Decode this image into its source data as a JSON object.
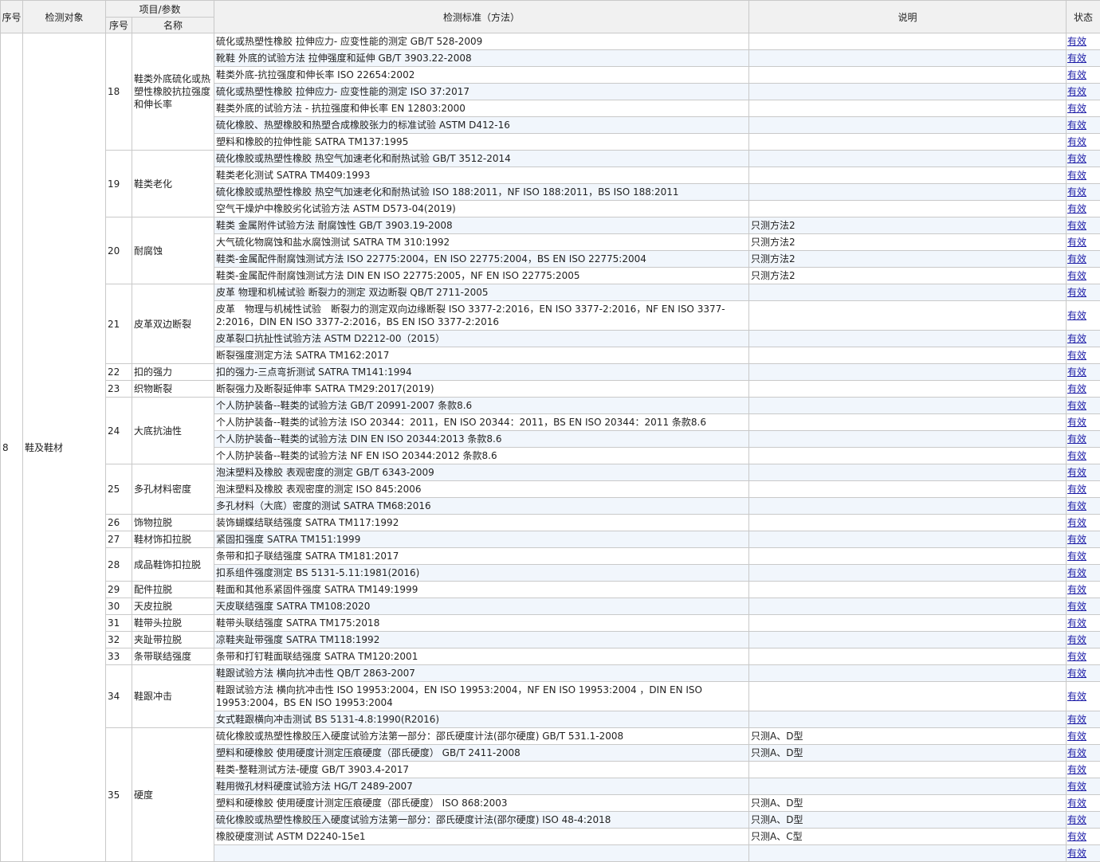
{
  "header": {
    "seq": "序号",
    "object": "检测对象",
    "project": "项目/参数",
    "sub_seq": "序号",
    "sub_name": "名称",
    "standard": "检测标准（方法）",
    "note": "说明",
    "status": "状态"
  },
  "object": {
    "seq": "8",
    "name": "鞋及鞋材"
  },
  "groups": [
    {
      "no": "18",
      "name": "鞋类外底硫化或热塑性橡胶抗拉强度和伸长率",
      "rows": [
        {
          "std": "硫化或热塑性橡胶 拉伸应力- 应变性能的测定 GB/T 528-2009",
          "note": "",
          "status": "有效"
        },
        {
          "std": "靴鞋 外底的试验方法 拉伸强度和延伸 GB/T 3903.22-2008",
          "note": "",
          "status": "有效"
        },
        {
          "std": "鞋类外底-抗拉强度和伸长率 ISO 22654:2002",
          "note": "",
          "status": "有效"
        },
        {
          "std": "硫化或热塑性橡胶 拉伸应力- 应变性能的测定 ISO 37:2017",
          "note": "",
          "status": "有效"
        },
        {
          "std": "鞋类外底的试验方法 - 抗拉强度和伸长率 EN 12803:2000",
          "note": "",
          "status": "有效"
        },
        {
          "std": "硫化橡胶、热塑橡胶和热塑合成橡胶张力的标准试验 ASTM D412-16",
          "note": "",
          "status": "有效"
        },
        {
          "std": "塑料和橡胶的拉伸性能 SATRA TM137:1995",
          "note": "",
          "status": "有效"
        }
      ]
    },
    {
      "no": "19",
      "name": "鞋类老化",
      "rows": [
        {
          "std": "硫化橡胶或热塑性橡胶 热空气加速老化和耐热试验 GB/T 3512-2014",
          "note": "",
          "status": "有效"
        },
        {
          "std": "鞋类老化测试 SATRA TM409:1993",
          "note": "",
          "status": "有效"
        },
        {
          "std": "硫化橡胶或热塑性橡胶 热空气加速老化和耐热试验 ISO 188:2011，NF ISO 188:2011，BS ISO 188:2011",
          "note": "",
          "status": "有效"
        },
        {
          "std": "空气干燥炉中橡胶劣化试验方法 ASTM D573-04(2019)",
          "note": "",
          "status": "有效"
        }
      ]
    },
    {
      "no": "20",
      "name": "耐腐蚀",
      "rows": [
        {
          "std": "鞋类 金属附件试验方法 耐腐蚀性 GB/T 3903.19-2008",
          "note": "只测方法2",
          "status": "有效"
        },
        {
          "std": "大气硫化物腐蚀和盐水腐蚀测试 SATRA TM 310:1992",
          "note": "只测方法2",
          "status": "有效"
        },
        {
          "std": "鞋类-金属配件耐腐蚀测试方法 ISO 22775:2004，EN ISO 22775:2004，BS EN ISO 22775:2004",
          "note": "只测方法2",
          "status": "有效"
        },
        {
          "std": "鞋类-金属配件耐腐蚀测试方法 DIN EN ISO 22775:2005，NF EN ISO 22775:2005",
          "note": "只测方法2",
          "status": "有效"
        }
      ]
    },
    {
      "no": "21",
      "name": "皮革双边断裂",
      "rows": [
        {
          "std": "皮革 物理和机械试验 断裂力的测定 双边断裂 QB/T 2711-2005",
          "note": "",
          "status": "有效"
        },
        {
          "std": "皮革　物理与机械性试验　断裂力的测定双向边缘断裂 ISO 3377-2:2016，EN ISO 3377-2:2016，NF EN ISO 3377-2:2016，DIN EN ISO 3377-2:2016，BS EN ISO 3377-2:2016",
          "note": "",
          "status": "有效",
          "tall": true
        },
        {
          "std": "皮革裂口抗扯性试验方法 ASTM D2212-00（2015）",
          "note": "",
          "status": "有效"
        },
        {
          "std": "断裂强度测定方法 SATRA TM162:2017",
          "note": "",
          "status": "有效"
        }
      ]
    },
    {
      "no": "22",
      "name": "扣的强力",
      "rows": [
        {
          "std": "扣的强力-三点弯折测试 SATRA TM141:1994",
          "note": "",
          "status": "有效"
        }
      ]
    },
    {
      "no": "23",
      "name": "织物断裂",
      "rows": [
        {
          "std": "断裂强力及断裂延伸率 SATRA TM29:2017(2019)",
          "note": "",
          "status": "有效"
        }
      ]
    },
    {
      "no": "24",
      "name": "大底抗油性",
      "rows": [
        {
          "std": "个人防护装备--鞋类的试验方法 GB/T 20991-2007 条款8.6",
          "note": "",
          "status": "有效"
        },
        {
          "std": "个人防护装备--鞋类的试验方法 ISO 20344：2011，EN ISO 20344：2011，BS EN ISO 20344：2011 条款8.6",
          "note": "",
          "status": "有效"
        },
        {
          "std": "个人防护装备--鞋类的试验方法 DIN EN ISO 20344:2013 条款8.6",
          "note": "",
          "status": "有效"
        },
        {
          "std": "个人防护装备--鞋类的试验方法 NF EN ISO 20344:2012 条款8.6",
          "note": "",
          "status": "有效"
        }
      ]
    },
    {
      "no": "25",
      "name": "多孔材料密度",
      "rows": [
        {
          "std": "泡沫塑料及橡胶 表观密度的测定 GB/T 6343-2009",
          "note": "",
          "status": "有效"
        },
        {
          "std": "泡沫塑料及橡胶 表观密度的测定 ISO 845:2006",
          "note": "",
          "status": "有效"
        },
        {
          "std": "多孔材料（大底）密度的测试 SATRA TM68:2016",
          "note": "",
          "status": "有效"
        }
      ]
    },
    {
      "no": "26",
      "name": "饰物拉脱",
      "rows": [
        {
          "std": "装饰蝴蝶结联结强度 SATRA TM117:1992",
          "note": "",
          "status": "有效"
        }
      ]
    },
    {
      "no": "27",
      "name": "鞋材饰扣拉脱",
      "rows": [
        {
          "std": "紧固扣强度 SATRA TM151:1999",
          "note": "",
          "status": "有效"
        }
      ]
    },
    {
      "no": "28",
      "name": "成品鞋饰扣拉脱",
      "rows": [
        {
          "std": "条带和扣子联结强度 SATRA TM181:2017",
          "note": "",
          "status": "有效"
        },
        {
          "std": "扣系组件强度测定 BS 5131-5.11:1981(2016)",
          "note": "",
          "status": "有效"
        }
      ]
    },
    {
      "no": "29",
      "name": "配件拉脱",
      "rows": [
        {
          "std": "鞋面和其他系紧固件强度 SATRA TM149:1999",
          "note": "",
          "status": "有效"
        }
      ]
    },
    {
      "no": "30",
      "name": "天皮拉脱",
      "rows": [
        {
          "std": "天皮联结强度 SATRA TM108:2020",
          "note": "",
          "status": "有效"
        }
      ]
    },
    {
      "no": "31",
      "name": "鞋带头拉脱",
      "rows": [
        {
          "std": "鞋带头联结强度 SATRA TM175:2018",
          "note": "",
          "status": "有效"
        }
      ]
    },
    {
      "no": "32",
      "name": "夹趾带拉脱",
      "rows": [
        {
          "std": "凉鞋夹趾带强度 SATRA TM118:1992",
          "note": "",
          "status": "有效"
        }
      ]
    },
    {
      "no": "33",
      "name": "条带联结强度",
      "rows": [
        {
          "std": "条带和打钉鞋面联结强度 SATRA TM120:2001",
          "note": "",
          "status": "有效"
        }
      ]
    },
    {
      "no": "34",
      "name": "鞋跟冲击",
      "rows": [
        {
          "std": "鞋跟试验方法 横向抗冲击性 QB/T 2863-2007",
          "note": "",
          "status": "有效"
        },
        {
          "std": "鞋跟试验方法 横向抗冲击性 ISO 19953:2004，EN ISO 19953:2004，NF EN ISO 19953:2004 ，DIN EN ISO 19953:2004，BS EN ISO 19953:2004",
          "note": "",
          "status": "有效",
          "tall": true
        },
        {
          "std": "女式鞋跟横向冲击测试 BS 5131-4.8:1990(R2016)",
          "note": "",
          "status": "有效"
        }
      ]
    },
    {
      "no": "35",
      "name": "硬度",
      "rows": [
        {
          "std": "硫化橡胶或热塑性橡胶压入硬度试验方法第一部分：邵氏硬度计法(邵尔硬度) GB/T 531.1-2008",
          "note": "只测A、D型",
          "status": "有效"
        },
        {
          "std": "塑料和硬橡胶 使用硬度计测定压痕硬度（邵氏硬度） GB/T 2411-2008",
          "note": "只测A、D型",
          "status": "有效"
        },
        {
          "std": "鞋类-整鞋测试方法-硬度 GB/T 3903.4-2017",
          "note": "",
          "status": "有效"
        },
        {
          "std": "鞋用微孔材料硬度试验方法 HG/T 2489-2007",
          "note": "",
          "status": "有效"
        },
        {
          "std": "塑料和硬橡胶 使用硬度计测定压痕硬度（邵氏硬度） ISO 868:2003",
          "note": "只测A、D型",
          "status": "有效"
        },
        {
          "std": "硫化橡胶或热塑性橡胶压入硬度试验方法第一部分：邵氏硬度计法(邵尔硬度) ISO 48-4:2018",
          "note": "只测A、D型",
          "status": "有效"
        },
        {
          "std": "橡胶硬度测试 ASTM D2240-15e1",
          "note": "只测A、C型",
          "status": "有效"
        },
        {
          "std": "",
          "note": "",
          "status": "有效"
        }
      ]
    }
  ]
}
